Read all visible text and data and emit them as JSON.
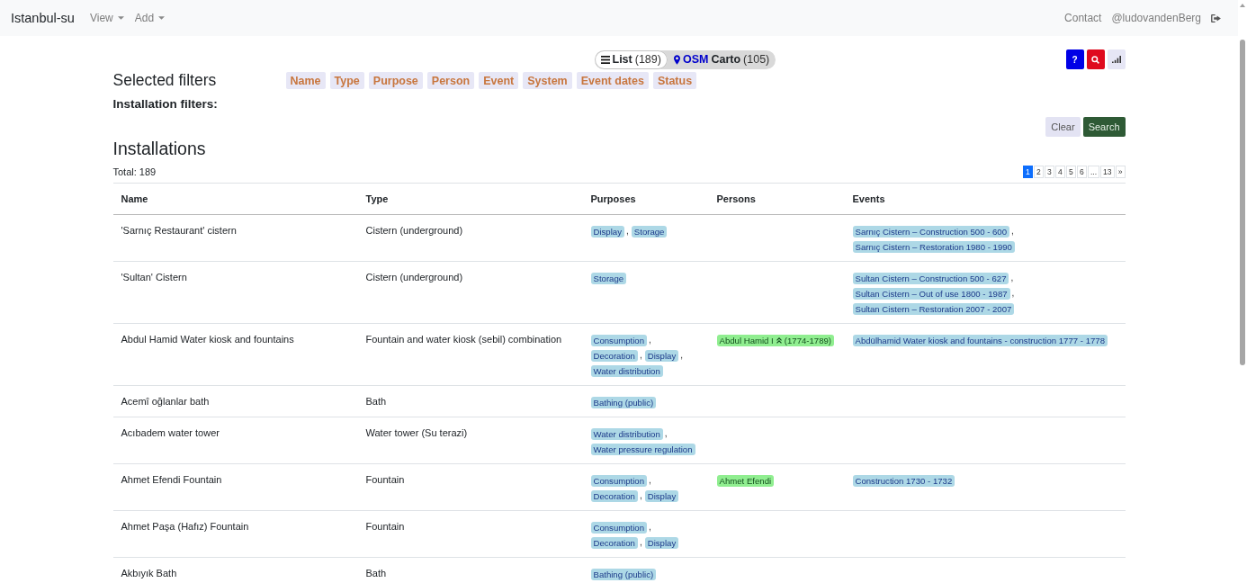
{
  "navbar": {
    "brand": "Istanbul-su",
    "menus": [
      {
        "label": "View"
      },
      {
        "label": "Add"
      }
    ],
    "links": [
      "Contact",
      "@ludovandenBerg"
    ]
  },
  "view_toggle": [
    {
      "kind": "list",
      "label": "List",
      "count": "(189)",
      "selected": true
    },
    {
      "kind": "map",
      "source": "OSM",
      "label": "Carto",
      "count": "(105)",
      "selected": false
    }
  ],
  "tool_buttons": [
    {
      "kind": "help",
      "text": "?"
    },
    {
      "kind": "search"
    },
    {
      "kind": "chart"
    }
  ],
  "filters": {
    "title": "Selected filters",
    "chips": [
      "Name",
      "Type",
      "Purpose",
      "Person",
      "Event",
      "System",
      "Event dates",
      "Status"
    ],
    "subtitle": "Installation filters:"
  },
  "actions": [
    {
      "kind": "clear",
      "label": "Clear"
    },
    {
      "kind": "search",
      "label": "Search"
    }
  ],
  "installations": {
    "title": "Installations",
    "total": "Total: 189",
    "separator": ",",
    "pagination": [
      {
        "label": "1",
        "selected": true
      },
      {
        "label": "2",
        "selected": false
      },
      {
        "label": "3",
        "selected": false
      },
      {
        "label": "4",
        "selected": false
      },
      {
        "label": "5",
        "selected": false
      },
      {
        "label": "6",
        "selected": false
      },
      {
        "label": "...",
        "selected": false
      },
      {
        "label": "13",
        "selected": false
      },
      {
        "label": "»",
        "selected": false
      }
    ],
    "columns": [
      "Name",
      "Type",
      "Purposes",
      "Persons",
      "Events"
    ],
    "rows": [
      {
        "name": "'Sarnıç Restaurant' cistern",
        "type": "Cistern (underground)",
        "purposes": [
          "Display",
          "Storage"
        ],
        "events": [
          "Sarnıç Cistern – Construction 500 - 600",
          "Sarnıç Cistern – Restoration 1980 - 1990"
        ]
      },
      {
        "name": "'Sultan' Cistern",
        "type": "Cistern (underground)",
        "purposes": [
          "Storage"
        ],
        "events": [
          "Sultan Cistern – Construction 500 - 627",
          "Sultan Cistern – Out of use 1800 - 1987",
          "Sultan Cistern – Restoration 2007 - 2007"
        ]
      },
      {
        "name": "Abdul Hamid Water kiosk and fountains",
        "type": "Fountain and water kiosk (sebil) combination",
        "purposes": [
          "Consumption",
          "Decoration",
          "Display",
          "Water distribution"
        ],
        "persons": [
          {
            "kind": "marked",
            "name": "Abdul Hamid I",
            "dates": "(1774-1789)"
          }
        ],
        "events": [
          "Abdülhamid Water kiosk and fountains - construction 1777 - 1778"
        ]
      },
      {
        "name": "Acemî oğlanlar bath",
        "type": "Bath",
        "purposes": [
          "Bathing (public)"
        ]
      },
      {
        "name": "Acıbadem water tower",
        "type": "Water tower (Su terazi)",
        "purposes": [
          "Water distribution",
          "Water pressure regulation"
        ]
      },
      {
        "name": "Ahmet Efendi Fountain",
        "type": "Fountain",
        "purposes": [
          "Consumption",
          "Decoration",
          "Display"
        ],
        "persons": [
          {
            "kind": "plain",
            "name": "Ahmet Efendi"
          }
        ],
        "events": [
          "Construction 1730 - 1732"
        ]
      },
      {
        "name": "Ahmet Paşa (Hafız) Fountain",
        "type": "Fountain",
        "purposes": [
          "Consumption",
          "Decoration",
          "Display"
        ]
      },
      {
        "name": "Akbıyık Bath",
        "type": "Bath",
        "purposes": [
          "Bathing (public)"
        ]
      }
    ]
  }
}
